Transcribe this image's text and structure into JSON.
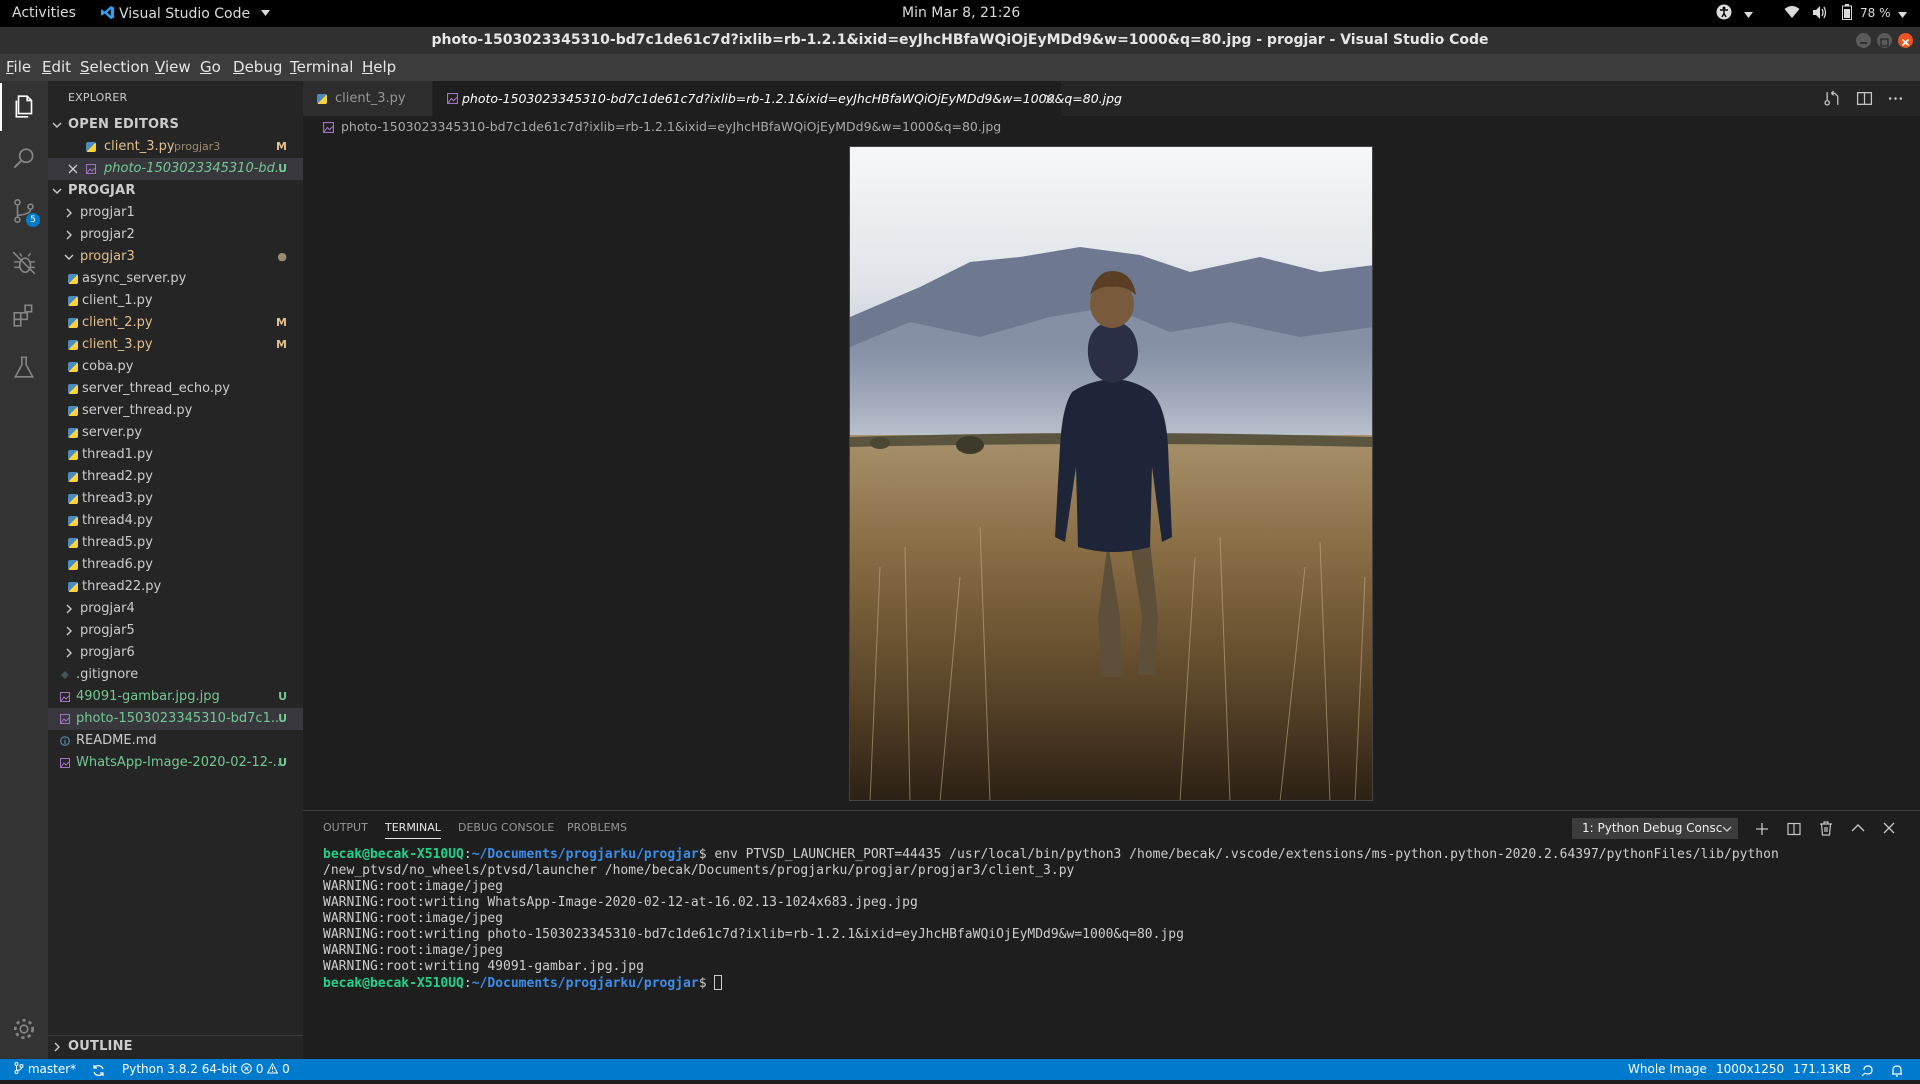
{
  "gnome": {
    "activities": "Activities",
    "app_name": "Visual Studio Code",
    "clock": "Min Mar  8, 21:26",
    "battery": "78 %"
  },
  "window": {
    "title": "photo-1503023345310-bd7c1de61c7d?ixlib=rb-1.2.1&ixid=eyJhcHBfaWQiOjEyMDd9&w=1000&q=80.jpg - progjar - Visual Studio Code"
  },
  "menu": [
    {
      "label": "File",
      "u": "F",
      "rest": "ile"
    },
    {
      "label": "Edit",
      "u": "E",
      "rest": "dit"
    },
    {
      "label": "Selection",
      "u": "S",
      "rest": "election"
    },
    {
      "label": "View",
      "u": "V",
      "rest": "iew"
    },
    {
      "label": "Go",
      "u": "G",
      "rest": "o"
    },
    {
      "label": "Debug",
      "u": "D",
      "rest": "ebug"
    },
    {
      "label": "Terminal",
      "u": "T",
      "rest": "erminal"
    },
    {
      "label": "Help",
      "u": "H",
      "rest": "elp"
    }
  ],
  "activity": {
    "scm_badge": "5"
  },
  "sidebar": {
    "explorer_title": "EXPLORER",
    "open_editors_title": "OPEN EDITORS",
    "open_editors": [
      {
        "name": "client_3.py",
        "folder": "progjar3",
        "badge": "M"
      },
      {
        "name": "photo-1503023345310-bd...",
        "badge": "U"
      }
    ],
    "workspace_title": "PROGJAR",
    "tree": [
      {
        "name": "progjar1",
        "type": "folder"
      },
      {
        "name": "progjar2",
        "type": "folder"
      },
      {
        "name": "progjar3",
        "type": "folder-open",
        "badge": "●"
      },
      {
        "name": "async_server.py",
        "type": "py"
      },
      {
        "name": "client_1.py",
        "type": "py"
      },
      {
        "name": "client_2.py",
        "type": "py",
        "badge": "M"
      },
      {
        "name": "client_3.py",
        "type": "py",
        "badge": "M"
      },
      {
        "name": "coba.py",
        "type": "py"
      },
      {
        "name": "server_thread_echo.py",
        "type": "py"
      },
      {
        "name": "server_thread.py",
        "type": "py"
      },
      {
        "name": "server.py",
        "type": "py"
      },
      {
        "name": "thread1.py",
        "type": "py"
      },
      {
        "name": "thread2.py",
        "type": "py"
      },
      {
        "name": "thread3.py",
        "type": "py"
      },
      {
        "name": "thread4.py",
        "type": "py"
      },
      {
        "name": "thread5.py",
        "type": "py"
      },
      {
        "name": "thread6.py",
        "type": "py"
      },
      {
        "name": "thread22.py",
        "type": "py"
      },
      {
        "name": "progjar4",
        "type": "folder"
      },
      {
        "name": "progjar5",
        "type": "folder"
      },
      {
        "name": "progjar6",
        "type": "folder"
      },
      {
        "name": ".gitignore",
        "type": "git"
      },
      {
        "name": "49091-gambar.jpg.jpg",
        "type": "img",
        "badge": "U"
      },
      {
        "name": "photo-1503023345310-bd7c1...",
        "type": "img",
        "badge": "U"
      },
      {
        "name": "README.md",
        "type": "info"
      },
      {
        "name": "WhatsApp-Image-2020-02-12-...",
        "type": "img",
        "badge": "U"
      }
    ],
    "outline_title": "OUTLINE"
  },
  "tabs": [
    {
      "label": "client_3.py"
    },
    {
      "label": "photo-1503023345310-bd7c1de61c7d?ixlib=rb-1.2.1&ixid=eyJhcHBfaWQiOjEyMDd9&w=1000&q=80.jpg"
    }
  ],
  "breadcrumb": "photo-1503023345310-bd7c1de61c7d?ixlib=rb-1.2.1&ixid=eyJhcHBfaWQiOjEyMDd9&w=1000&q=80.jpg",
  "panel": {
    "tabs": [
      "OUTPUT",
      "TERMINAL",
      "DEBUG CONSOLE",
      "PROBLEMS"
    ],
    "active_tab": "TERMINAL",
    "terminal_select": "1: Python Debug Consc",
    "terminal": {
      "user": "becak@becak-X510UQ",
      "path": "~/Documents/progjarku/progjar",
      "command": "env PTVSD_LAUNCHER_PORT=44435 /usr/local/bin/python3 /home/becak/.vscode/extensions/ms-python.python-2020.2.64397/pythonFiles/lib/python",
      "command_cont": "/new_ptvsd/no_wheels/ptvsd/launcher /home/becak/Documents/progjarku/progjar/progjar3/client_3.py",
      "lines": [
        "WARNING:root:image/jpeg",
        "WARNING:root:writing WhatsApp-Image-2020-02-12-at-16.02.13-1024x683.jpeg.jpg",
        "WARNING:root:image/jpeg",
        "WARNING:root:writing photo-1503023345310-bd7c1de61c7d?ixlib=rb-1.2.1&ixid=eyJhcHBfaWQiOjEyMDd9&w=1000&q=80.jpg",
        "WARNING:root:image/jpeg",
        "WARNING:root:writing 49091-gambar.jpg.jpg"
      ]
    }
  },
  "status": {
    "branch": "master*",
    "python": "Python 3.8.2 64-bit",
    "errors": "0",
    "warnings": "0",
    "image_mode": "Whole Image",
    "dimensions": "1000x1250",
    "filesize": "171.13KB"
  },
  "colors": {
    "accent": "#007acc",
    "modified": "#e2c08d",
    "untracked": "#73c991"
  }
}
